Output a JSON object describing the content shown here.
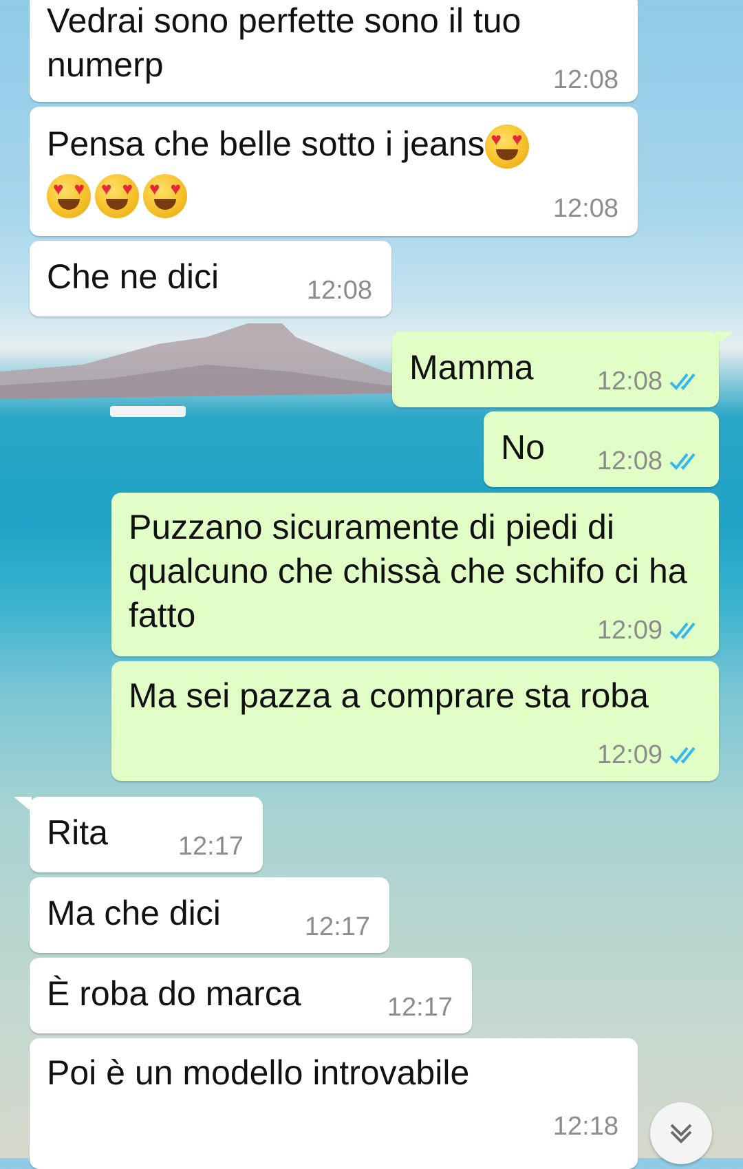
{
  "messages": [
    {
      "dir": "in",
      "text": "Vedrai sono perfette sono il tuo numerp",
      "time": "12:08"
    },
    {
      "dir": "in",
      "text": "Pensa che belle sotto i jeans",
      "emoji": [
        "heart-eyes",
        "heart-eyes",
        "heart-eyes",
        "heart-eyes"
      ],
      "time": "12:08"
    },
    {
      "dir": "in",
      "text": "Che ne dici",
      "time": "12:08"
    },
    {
      "dir": "out",
      "text": "Mamma",
      "time": "12:08",
      "status": "read"
    },
    {
      "dir": "out",
      "text": "No",
      "time": "12:08",
      "status": "read"
    },
    {
      "dir": "out",
      "text": "Puzzano sicuramente di piedi di qualcuno che chissà che schifo ci ha fatto",
      "time": "12:09",
      "status": "read"
    },
    {
      "dir": "out",
      "text": "Ma sei pazza a comprare sta roba",
      "time": "12:09",
      "status": "read"
    },
    {
      "dir": "in",
      "text": "Rita",
      "time": "12:17"
    },
    {
      "dir": "in",
      "text": "Ma che dici",
      "time": "12:17"
    },
    {
      "dir": "in",
      "text": "È roba do marca",
      "time": "12:17"
    },
    {
      "dir": "in",
      "text": "Poi è un modello introvabile",
      "time": "12:18"
    }
  ],
  "scroll_button": {
    "icon": "double-chevron-down-icon"
  },
  "colors": {
    "incoming": "#ffffff",
    "outgoing": "#e1fec6",
    "ticks": "#34b7f1",
    "time": "#8c8c8c"
  }
}
